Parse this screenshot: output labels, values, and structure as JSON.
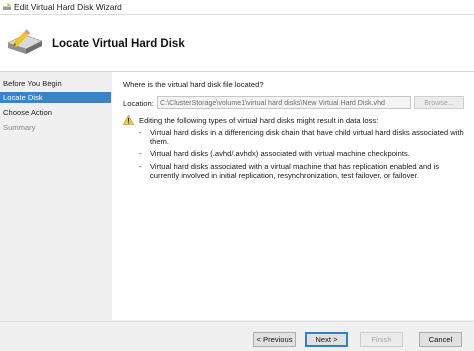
{
  "window": {
    "title": "Edit Virtual Hard Disk Wizard"
  },
  "header": {
    "heading": "Locate Virtual Hard Disk"
  },
  "nav": {
    "items": [
      {
        "label": "Before You Begin"
      },
      {
        "label": "Locate Disk"
      },
      {
        "label": "Choose Action"
      },
      {
        "label": "Summary"
      }
    ],
    "active": "Locate Disk"
  },
  "content": {
    "question": "Where is the virtual hard disk file located?",
    "location_label": "Location:",
    "location_value": "C:\\ClusterStorage\\volume1\\virtual hard disks\\New Virtual Hard Disk.vhd",
    "browse_label": "Browse...",
    "warning_text": "Editing the following types of virtual hard disks might result in data loss:",
    "warning_items": [
      {
        "bullet": "-",
        "text": "Virtual hard disks in a differencing disk chain that have child virtual hard disks associated with them."
      },
      {
        "bullet": "-",
        "text": "Virtual hard disks (.avhd/.avhdx) associated with virtual machine checkpoints."
      },
      {
        "bullet": "-",
        "text": "Virtual hard disks associated with a virtual machine that has replication enabled and is currently involved in initial replication, resynchronization, test failover, or failover."
      }
    ]
  },
  "footer": {
    "previous_label": "< Previous",
    "next_label": "Next >",
    "finish_label": "Finish",
    "cancel_label": "Cancel"
  },
  "colors": {
    "accent": "#3c82c6",
    "warning": "#f2c94c"
  }
}
